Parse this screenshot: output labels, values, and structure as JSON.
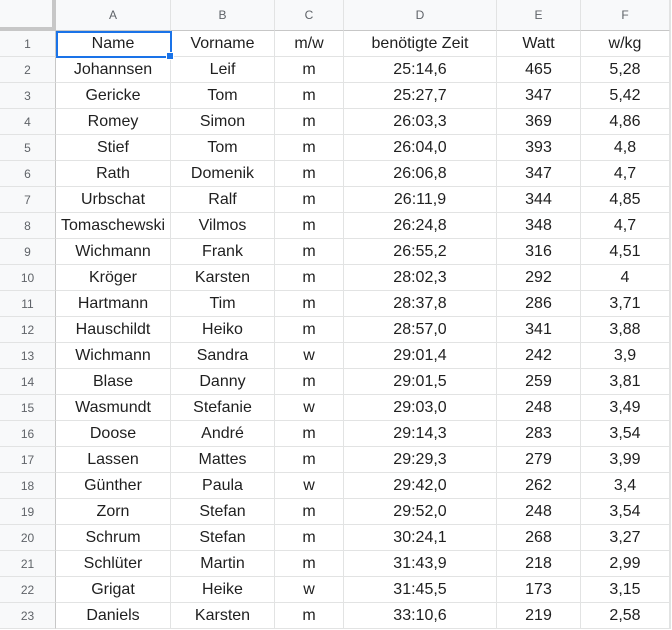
{
  "columns": [
    "A",
    "B",
    "C",
    "D",
    "E",
    "F"
  ],
  "rows": [
    {
      "n": "1",
      "cells": [
        "Name",
        "Vorname",
        "m/w",
        "benötigte Zeit",
        "Watt",
        "w/kg"
      ]
    },
    {
      "n": "2",
      "cells": [
        "Johannsen",
        "Leif",
        "m",
        "25:14,6",
        "465",
        "5,28"
      ]
    },
    {
      "n": "3",
      "cells": [
        "Gericke",
        "Tom",
        "m",
        "25:27,7",
        "347",
        "5,42"
      ]
    },
    {
      "n": "4",
      "cells": [
        "Romey",
        "Simon",
        "m",
        "26:03,3",
        "369",
        "4,86"
      ]
    },
    {
      "n": "5",
      "cells": [
        "Stief",
        "Tom",
        "m",
        "26:04,0",
        "393",
        "4,8"
      ]
    },
    {
      "n": "6",
      "cells": [
        "Rath",
        "Domenik",
        "m",
        "26:06,8",
        "347",
        "4,7"
      ]
    },
    {
      "n": "7",
      "cells": [
        "Urbschat",
        "Ralf",
        "m",
        "26:11,9",
        "344",
        "4,85"
      ]
    },
    {
      "n": "8",
      "cells": [
        "Tomaschewski",
        "Vilmos",
        "m",
        "26:24,8",
        "348",
        "4,7"
      ]
    },
    {
      "n": "9",
      "cells": [
        "Wichmann",
        "Frank",
        "m",
        "26:55,2",
        "316",
        "4,51"
      ]
    },
    {
      "n": "10",
      "cells": [
        "Kröger",
        "Karsten",
        "m",
        "28:02,3",
        "292",
        "4"
      ]
    },
    {
      "n": "11",
      "cells": [
        "Hartmann",
        "Tim",
        "m",
        "28:37,8",
        "286",
        "3,71"
      ]
    },
    {
      "n": "12",
      "cells": [
        "Hauschildt",
        "Heiko",
        "m",
        "28:57,0",
        "341",
        "3,88"
      ]
    },
    {
      "n": "13",
      "cells": [
        "Wichmann",
        "Sandra",
        "w",
        "29:01,4",
        "242",
        "3,9"
      ]
    },
    {
      "n": "14",
      "cells": [
        "Blase",
        "Danny",
        "m",
        "29:01,5",
        "259",
        "3,81"
      ]
    },
    {
      "n": "15",
      "cells": [
        "Wasmundt",
        "Stefanie",
        "w",
        "29:03,0",
        "248",
        "3,49"
      ]
    },
    {
      "n": "16",
      "cells": [
        "Doose",
        "André",
        "m",
        "29:14,3",
        "283",
        "3,54"
      ]
    },
    {
      "n": "17",
      "cells": [
        "Lassen",
        "Mattes",
        "m",
        "29:29,3",
        "279",
        "3,99"
      ]
    },
    {
      "n": "18",
      "cells": [
        "Günther",
        "Paula",
        "w",
        "29:42,0",
        "262",
        "3,4"
      ]
    },
    {
      "n": "19",
      "cells": [
        "Zorn",
        "Stefan",
        "m",
        "29:52,0",
        "248",
        "3,54"
      ]
    },
    {
      "n": "20",
      "cells": [
        "Schrum",
        "Stefan",
        "m",
        "30:24,1",
        "268",
        "3,27"
      ]
    },
    {
      "n": "21",
      "cells": [
        "Schlüter",
        "Martin",
        "m",
        "31:43,9",
        "218",
        "2,99"
      ]
    },
    {
      "n": "22",
      "cells": [
        "Grigat",
        "Heike",
        "w",
        "31:45,5",
        "173",
        "3,15"
      ]
    },
    {
      "n": "23",
      "cells": [
        "Daniels",
        "Karsten",
        "m",
        "33:10,6",
        "219",
        "2,58"
      ]
    }
  ],
  "selected_cell": "A1",
  "colors": {
    "selection": "#1a73e8",
    "header_bg": "#f8f9fa",
    "gridline": "#e2e3e3"
  }
}
